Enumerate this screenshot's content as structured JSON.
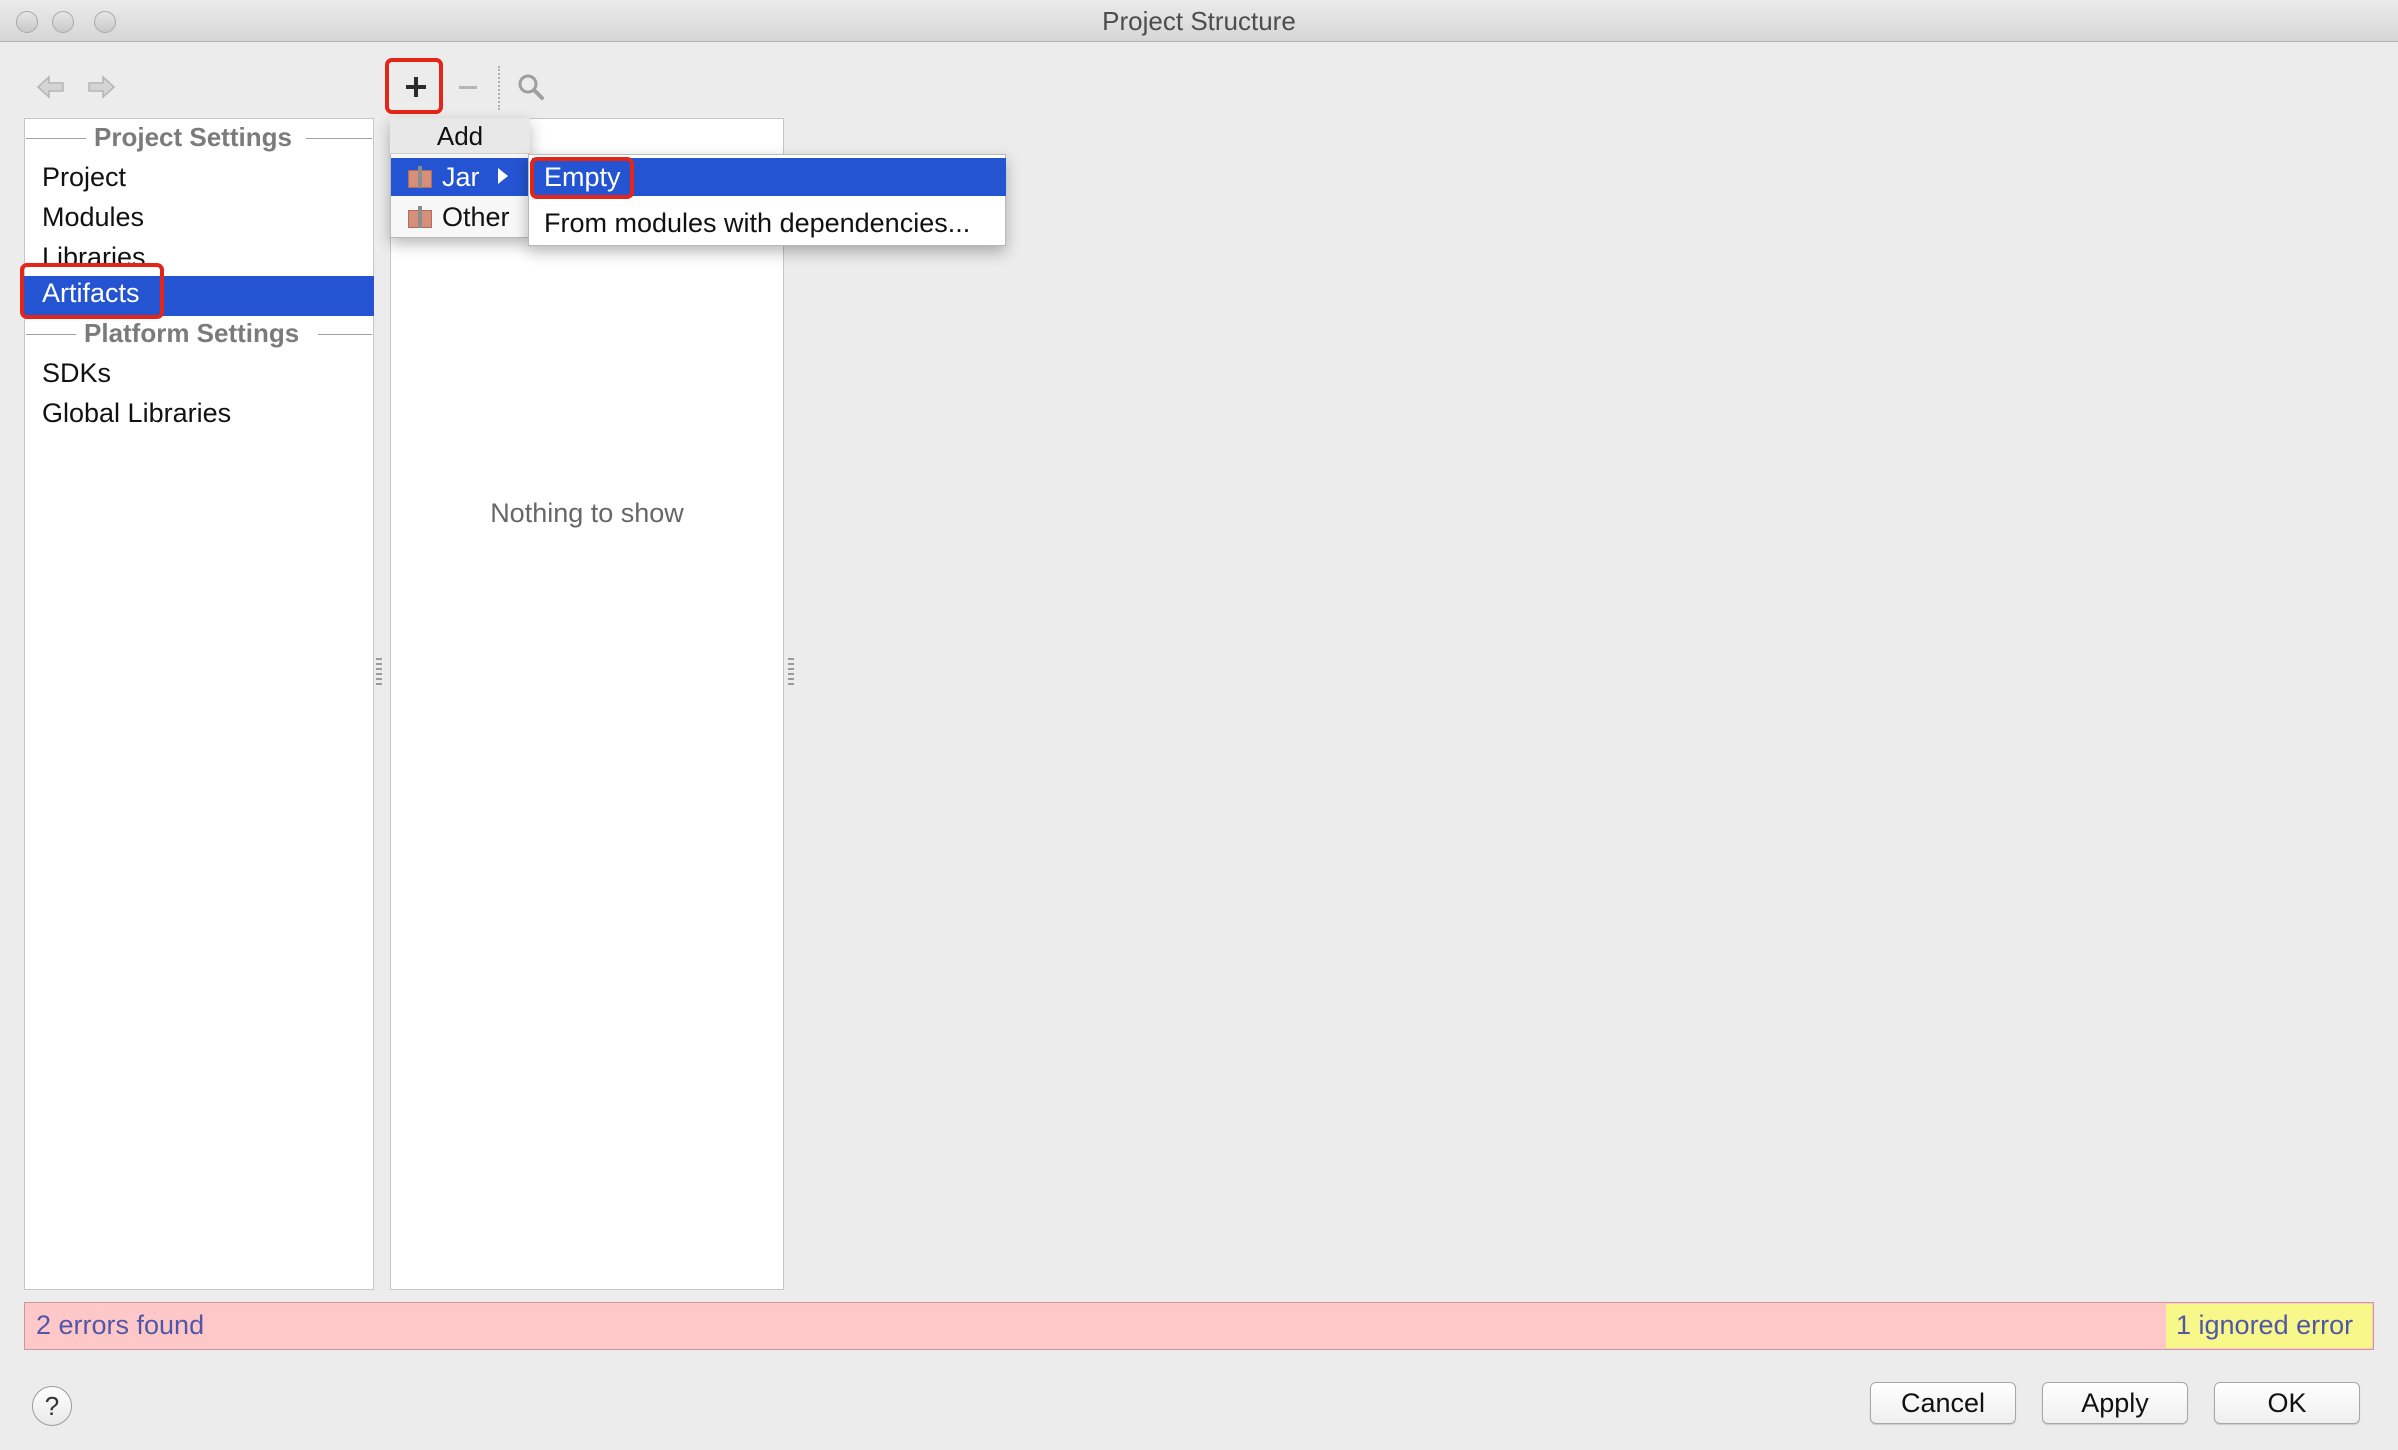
{
  "window": {
    "title": "Project Structure"
  },
  "toolbar": {
    "back_icon": "arrow-left-icon",
    "forward_icon": "arrow-right-icon",
    "add_icon": "plus-icon",
    "remove_icon": "minus-icon",
    "find_icon": "magnifier-icon"
  },
  "sidebar": {
    "project_settings_header": "Project Settings",
    "project_items": [
      "Project",
      "Modules",
      "Libraries",
      "Artifacts"
    ],
    "selected": "Artifacts",
    "platform_settings_header": "Platform Settings",
    "platform_items": [
      "SDKs",
      "Global Libraries"
    ]
  },
  "artifacts_panel": {
    "empty_text": "Nothing to show"
  },
  "add_menu": {
    "title": "Add",
    "items": [
      {
        "label": "Jar",
        "icon": "jar-icon",
        "has_submenu": true
      },
      {
        "label": "Other",
        "icon": "jar-icon"
      }
    ],
    "jar_submenu": {
      "items": [
        "Empty",
        "From modules with dependencies..."
      ],
      "selected": "Empty"
    }
  },
  "status": {
    "errors": "2 errors found",
    "ignored": "1 ignored error"
  },
  "buttons": {
    "help": "?",
    "cancel": "Cancel",
    "apply": "Apply",
    "ok": "OK"
  },
  "colors": {
    "selection": "#2454d1",
    "highlight_box": "#e32618",
    "error_bar": "#ffc8c8",
    "ignored_bg": "#f7f78a",
    "error_text": "#5157a8"
  }
}
